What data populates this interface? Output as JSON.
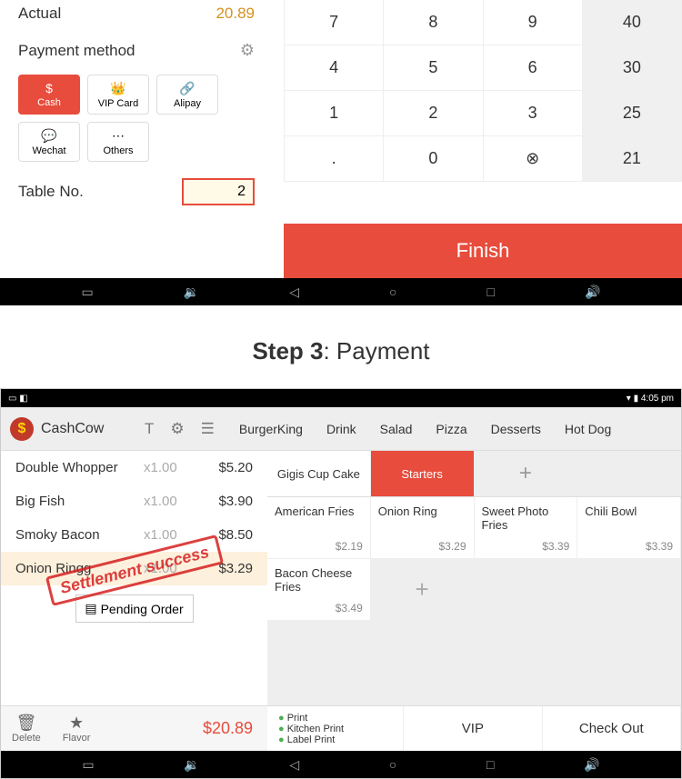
{
  "top": {
    "actual_label": "Actual",
    "actual_value": "20.89",
    "payment_method_label": "Payment method",
    "methods": [
      {
        "icon": "$",
        "label": "Cash",
        "active": true
      },
      {
        "icon": "👑",
        "label": "VIP Card",
        "active": false
      },
      {
        "icon": "🔗",
        "label": "Alipay",
        "active": false
      },
      {
        "icon": "💬",
        "label": "Wechat",
        "active": false
      },
      {
        "icon": "⋯",
        "label": "Others",
        "active": false
      }
    ],
    "table_label": "Table No.",
    "table_value": "2",
    "keypad": [
      "7",
      "8",
      "9",
      "40",
      "4",
      "5",
      "6",
      "30",
      "1",
      "2",
      "3",
      "25",
      ".",
      "0",
      "⊗",
      "21"
    ],
    "finish_label": "Finish"
  },
  "step_title_bold": "Step 3",
  "step_title_rest": ": Payment",
  "status_time": "4:05 pm",
  "app": {
    "name": "CashCow",
    "categories": [
      "BurgerKing",
      "Drink",
      "Salad",
      "Pizza",
      "Desserts",
      "Hot Dog"
    ],
    "subcats": [
      {
        "label": "Gigis Cup Cake",
        "active": false
      },
      {
        "label": "Starters",
        "active": true
      },
      {
        "label": "+",
        "plus": true
      }
    ],
    "foods": [
      {
        "name": "American Fries",
        "price": "$2.19"
      },
      {
        "name": "Onion Ring",
        "price": "$3.29"
      },
      {
        "name": "Sweet Photo Fries",
        "price": "$3.39"
      },
      {
        "name": "Chili Bowl",
        "price": "$3.39"
      },
      {
        "name": "Bacon Cheese Fries",
        "price": "$3.49"
      }
    ],
    "order": [
      {
        "name": "Double Whopper",
        "qty": "x1.00",
        "price": "$5.20"
      },
      {
        "name": "Big Fish",
        "qty": "x1.00",
        "price": "$3.90"
      },
      {
        "name": "Smoky Bacon",
        "qty": "x1.00",
        "price": "$8.50"
      },
      {
        "name": "Onion Ringg",
        "qty": "x1.00",
        "price": "$3.29",
        "sel": true
      }
    ],
    "pending_label": "Pending Order",
    "stamp": "Settlement success",
    "delete_label": "Delete",
    "flavor_label": "Flavor",
    "total": "$20.89",
    "print_labels": [
      "Print",
      "Kitchen Print",
      "Label Print"
    ],
    "vip_label": "VIP",
    "checkout_label": "Check Out"
  }
}
